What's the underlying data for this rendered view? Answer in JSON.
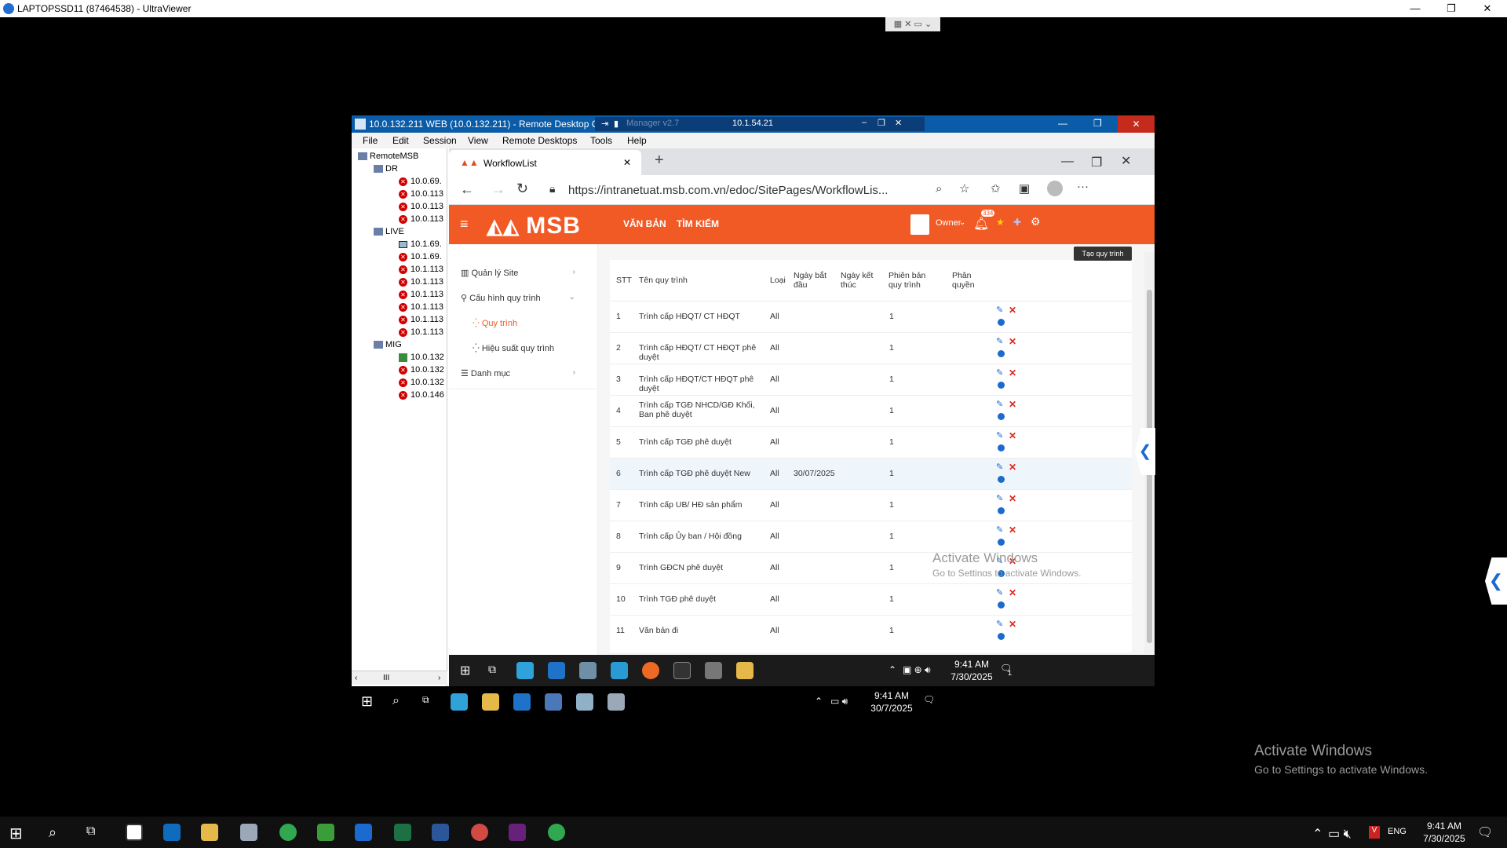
{
  "uv": {
    "title": "LAPTOPSSD11 (87464538) - UltraViewer",
    "minimize": "—",
    "restore": "❐",
    "close": "✕"
  },
  "rdc": {
    "title": "10.0.132.211 WEB (10.0.132.211) - Remote Desktop C",
    "conn_label": "10.1.54.21",
    "conn_ghost": "Manager v2.7",
    "menu": [
      "File",
      "Edit",
      "Session",
      "View",
      "Remote Desktops",
      "Tools",
      "Help"
    ],
    "tree": {
      "root": "RemoteMSB",
      "groups": [
        {
          "name": "DR",
          "items": [
            "10.0.69.",
            "10.0.113",
            "10.0.113",
            "10.0.113"
          ]
        },
        {
          "name": "LIVE",
          "items": [
            "10.1.69.",
            "10.1.69.",
            "10.1.113",
            "10.1.113",
            "10.1.113",
            "10.1.113",
            "10.1.113",
            "10.1.113"
          ]
        },
        {
          "name": "MIG",
          "items": [
            "10.0.132",
            "10.0.132",
            "10.0.132",
            "10.0.146"
          ]
        }
      ],
      "scroll_label": "III"
    }
  },
  "browser": {
    "tab_title": "WorkflowList",
    "tab_close": "✕",
    "new_tab": "+",
    "url": "https://intranetuat.msb.com.vn/edoc/SitePages/WorkflowLis..."
  },
  "app": {
    "logo": "MSB",
    "nav": [
      "VĂN BẢN",
      "TÌM KIẾM"
    ],
    "user": "Owner",
    "badge": "334",
    "tooltip": "Tạo quy trình",
    "sidebar": [
      {
        "label": "Quản lý Site"
      },
      {
        "label": "Cấu hình quy trình"
      },
      {
        "label": "Quy trình"
      },
      {
        "label": "Hiệu suất quy trình"
      },
      {
        "label": "Danh mục"
      }
    ],
    "columns": [
      "STT",
      "Tên quy trình",
      "Loại",
      "Ngày bắt đầu",
      "Ngày kết thúc",
      "Phiên bản quy trình",
      "Phân quyền"
    ],
    "rows": [
      {
        "stt": "1",
        "name": "Trình cấp HĐQT/ CT HĐQT",
        "type": "All",
        "start": "",
        "ver": "1"
      },
      {
        "stt": "2",
        "name": "Trình cấp HĐQT/ CT HĐQT phê duyệt",
        "type": "All",
        "start": "",
        "ver": "1"
      },
      {
        "stt": "3",
        "name": "Trình cấp HĐQT/CT HĐQT phê duyệt",
        "type": "All",
        "start": "",
        "ver": "1"
      },
      {
        "stt": "4",
        "name": "Trình cấp TGĐ NHCD/GĐ Khối, Ban phê duyệt",
        "type": "All",
        "start": "",
        "ver": "1"
      },
      {
        "stt": "5",
        "name": "Trình cấp TGĐ phê duyệt",
        "type": "All",
        "start": "",
        "ver": "1"
      },
      {
        "stt": "6",
        "name": "Trình cấp TGĐ phê duyệt New",
        "type": "All",
        "start": "30/07/2025",
        "ver": "1"
      },
      {
        "stt": "7",
        "name": "Trình cấp UB/ HĐ sản phẩm",
        "type": "All",
        "start": "",
        "ver": "1"
      },
      {
        "stt": "8",
        "name": "Trình cấp Ủy ban / Hội đồng",
        "type": "All",
        "start": "",
        "ver": "1"
      },
      {
        "stt": "9",
        "name": "Trình GĐCN phê duyệt",
        "type": "All",
        "start": "",
        "ver": "1"
      },
      {
        "stt": "10",
        "name": "Trình TGĐ phê duyệt",
        "type": "All",
        "start": "",
        "ver": "1"
      },
      {
        "stt": "11",
        "name": "Văn bản đi",
        "type": "All",
        "start": "",
        "ver": "1"
      }
    ],
    "activate": [
      "Activate Windows",
      "Go to Settings to activate Windows."
    ]
  },
  "inner_taskbar": {
    "time": "9:41 AM",
    "date": "7/30/2025",
    "notif": "1"
  },
  "host_taskbar": {
    "time": "9:41 AM",
    "date": "30/7/2025"
  },
  "main_taskbar": {
    "time": "9:41 AM",
    "date": "7/30/2025",
    "lang": "ENG"
  },
  "watermark": {
    "line1": "Activate Windows",
    "line2": "Go to Settings to activate Windows."
  }
}
